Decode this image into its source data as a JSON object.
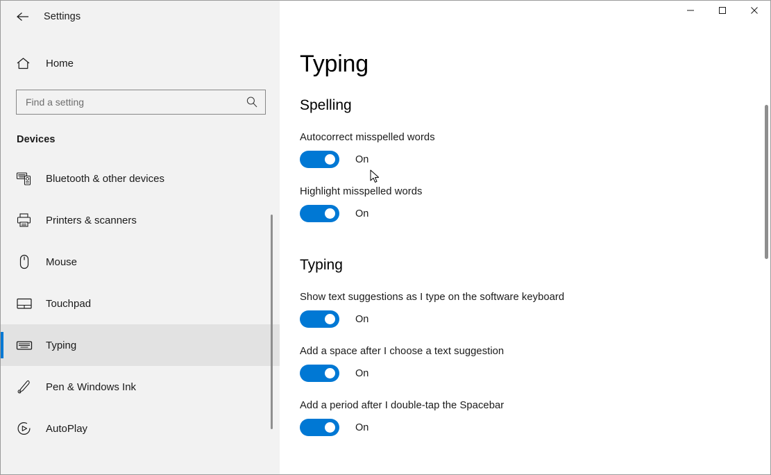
{
  "window": {
    "title": "Settings",
    "back_icon": "back-arrow-icon",
    "controls": {
      "minimize": "minimize-icon",
      "maximize": "maximize-icon",
      "close": "close-icon"
    }
  },
  "sidebar": {
    "home": {
      "label": "Home",
      "icon": "home-icon"
    },
    "search": {
      "placeholder": "Find a setting",
      "value": "",
      "icon": "search-icon"
    },
    "section_title": "Devices",
    "items": [
      {
        "label": "Bluetooth & other devices",
        "icon": "bluetooth-devices-icon",
        "selected": false
      },
      {
        "label": "Printers & scanners",
        "icon": "printer-icon",
        "selected": false
      },
      {
        "label": "Mouse",
        "icon": "mouse-icon",
        "selected": false
      },
      {
        "label": "Touchpad",
        "icon": "touchpad-icon",
        "selected": false
      },
      {
        "label": "Typing",
        "icon": "keyboard-icon",
        "selected": true
      },
      {
        "label": "Pen & Windows Ink",
        "icon": "pen-icon",
        "selected": false
      },
      {
        "label": "AutoPlay",
        "icon": "autoplay-icon",
        "selected": false
      }
    ]
  },
  "main": {
    "page_title": "Typing",
    "groups": [
      {
        "heading": "Spelling",
        "settings": [
          {
            "label": "Autocorrect misspelled words",
            "state": "On",
            "enabled": true
          },
          {
            "label": "Highlight misspelled words",
            "state": "On",
            "enabled": true
          }
        ]
      },
      {
        "heading": "Typing",
        "settings": [
          {
            "label": "Show text suggestions as I type on the software keyboard",
            "state": "On",
            "enabled": true
          },
          {
            "label": "Add a space after I choose a text suggestion",
            "state": "On",
            "enabled": true
          },
          {
            "label": "Add a period after I double-tap the Spacebar",
            "state": "On",
            "enabled": true
          }
        ]
      }
    ]
  },
  "colors": {
    "accent": "#0078d4",
    "sidebar_bg": "#f2f2f2",
    "content_bg": "#ffffff",
    "text": "#1a1a1a"
  }
}
